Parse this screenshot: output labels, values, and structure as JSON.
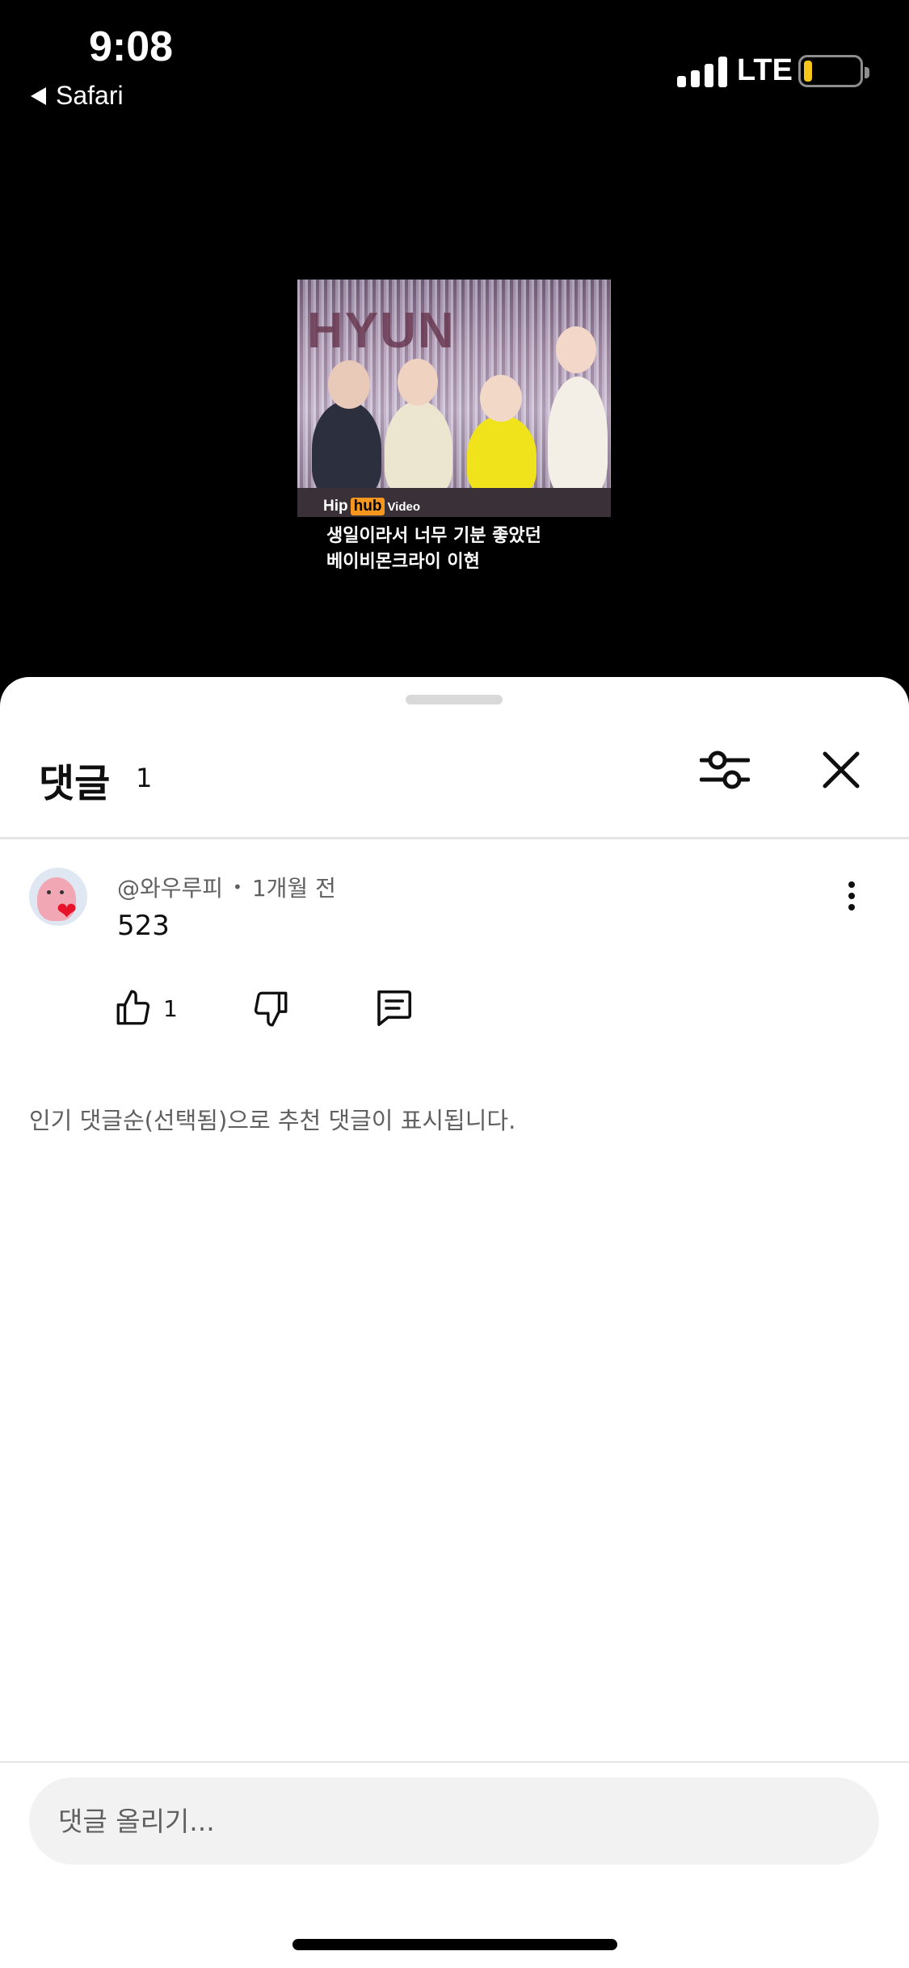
{
  "status_bar": {
    "time": "9:08",
    "back_app": "Safari",
    "network": "LTE",
    "battery_level": 0.15,
    "battery_color": "#f5c517"
  },
  "video": {
    "balloon_text": "HYUN",
    "watermark": {
      "hip": "Hip",
      "hub": "hub",
      "video": "Video"
    },
    "caption_line1": "생일이라서 너무 기분 좋았던",
    "caption_line2": "베이비몬크라이 이현"
  },
  "comments_sheet": {
    "title": "댓글",
    "count": "1",
    "filter_icon": "sliders-icon",
    "close_icon": "close-icon",
    "comments": [
      {
        "author": "@와우루피",
        "separator": "•",
        "time": "1개월 전",
        "text": "523",
        "likes": "1"
      }
    ],
    "sort_note": "인기 댓글순(선택됨)으로 추천 댓글이 표시됩니다.",
    "input_placeholder": "댓글 올리기..."
  }
}
